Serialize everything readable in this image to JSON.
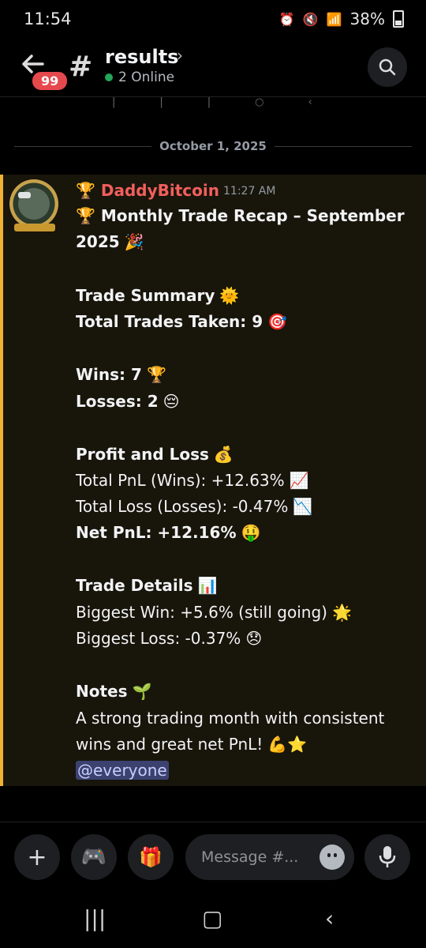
{
  "status_bar": {
    "time": "11:54",
    "battery": "38%"
  },
  "header": {
    "back_badge": "99",
    "channel_name": "results",
    "online_text": "2 Online"
  },
  "date_divider": "October 1, 2025",
  "message": {
    "author": "DaddyBitcoin",
    "timestamp": "11:27 AM",
    "lines": {
      "title_1": "Monthly Trade Recap – September",
      "title_2": "2025",
      "summary_h": "Trade Summary",
      "total_trades": "Total Trades Taken: 9",
      "wins": "Wins: 7",
      "losses": "Losses: 2",
      "pnl_h": "Profit and Loss",
      "total_pnl": "Total PnL (Wins): +12.63%",
      "total_loss": "Total Loss (Losses): -0.47%",
      "net_pnl": "Net PnL: +12.16%",
      "details_h": "Trade Details",
      "biggest_win": "Biggest Win: +5.6% (still going)",
      "biggest_loss": "Biggest Loss: -0.37%",
      "notes_h": "Notes",
      "notes_1": "A strong trading month with consistent",
      "notes_2": "wins and great net PnL!",
      "mention": "@everyone"
    }
  },
  "composer": {
    "placeholder": "Message #..."
  },
  "colors": {
    "accent_bar": "#f0b232",
    "author": "#f25f5c",
    "online": "#23a55a",
    "badge": "#e5484d"
  },
  "icons": [
    "back-arrow-icon",
    "hash-icon",
    "search-icon",
    "plus-icon",
    "gamepad-icon",
    "gift-icon",
    "emoji-icon",
    "microphone-icon"
  ]
}
